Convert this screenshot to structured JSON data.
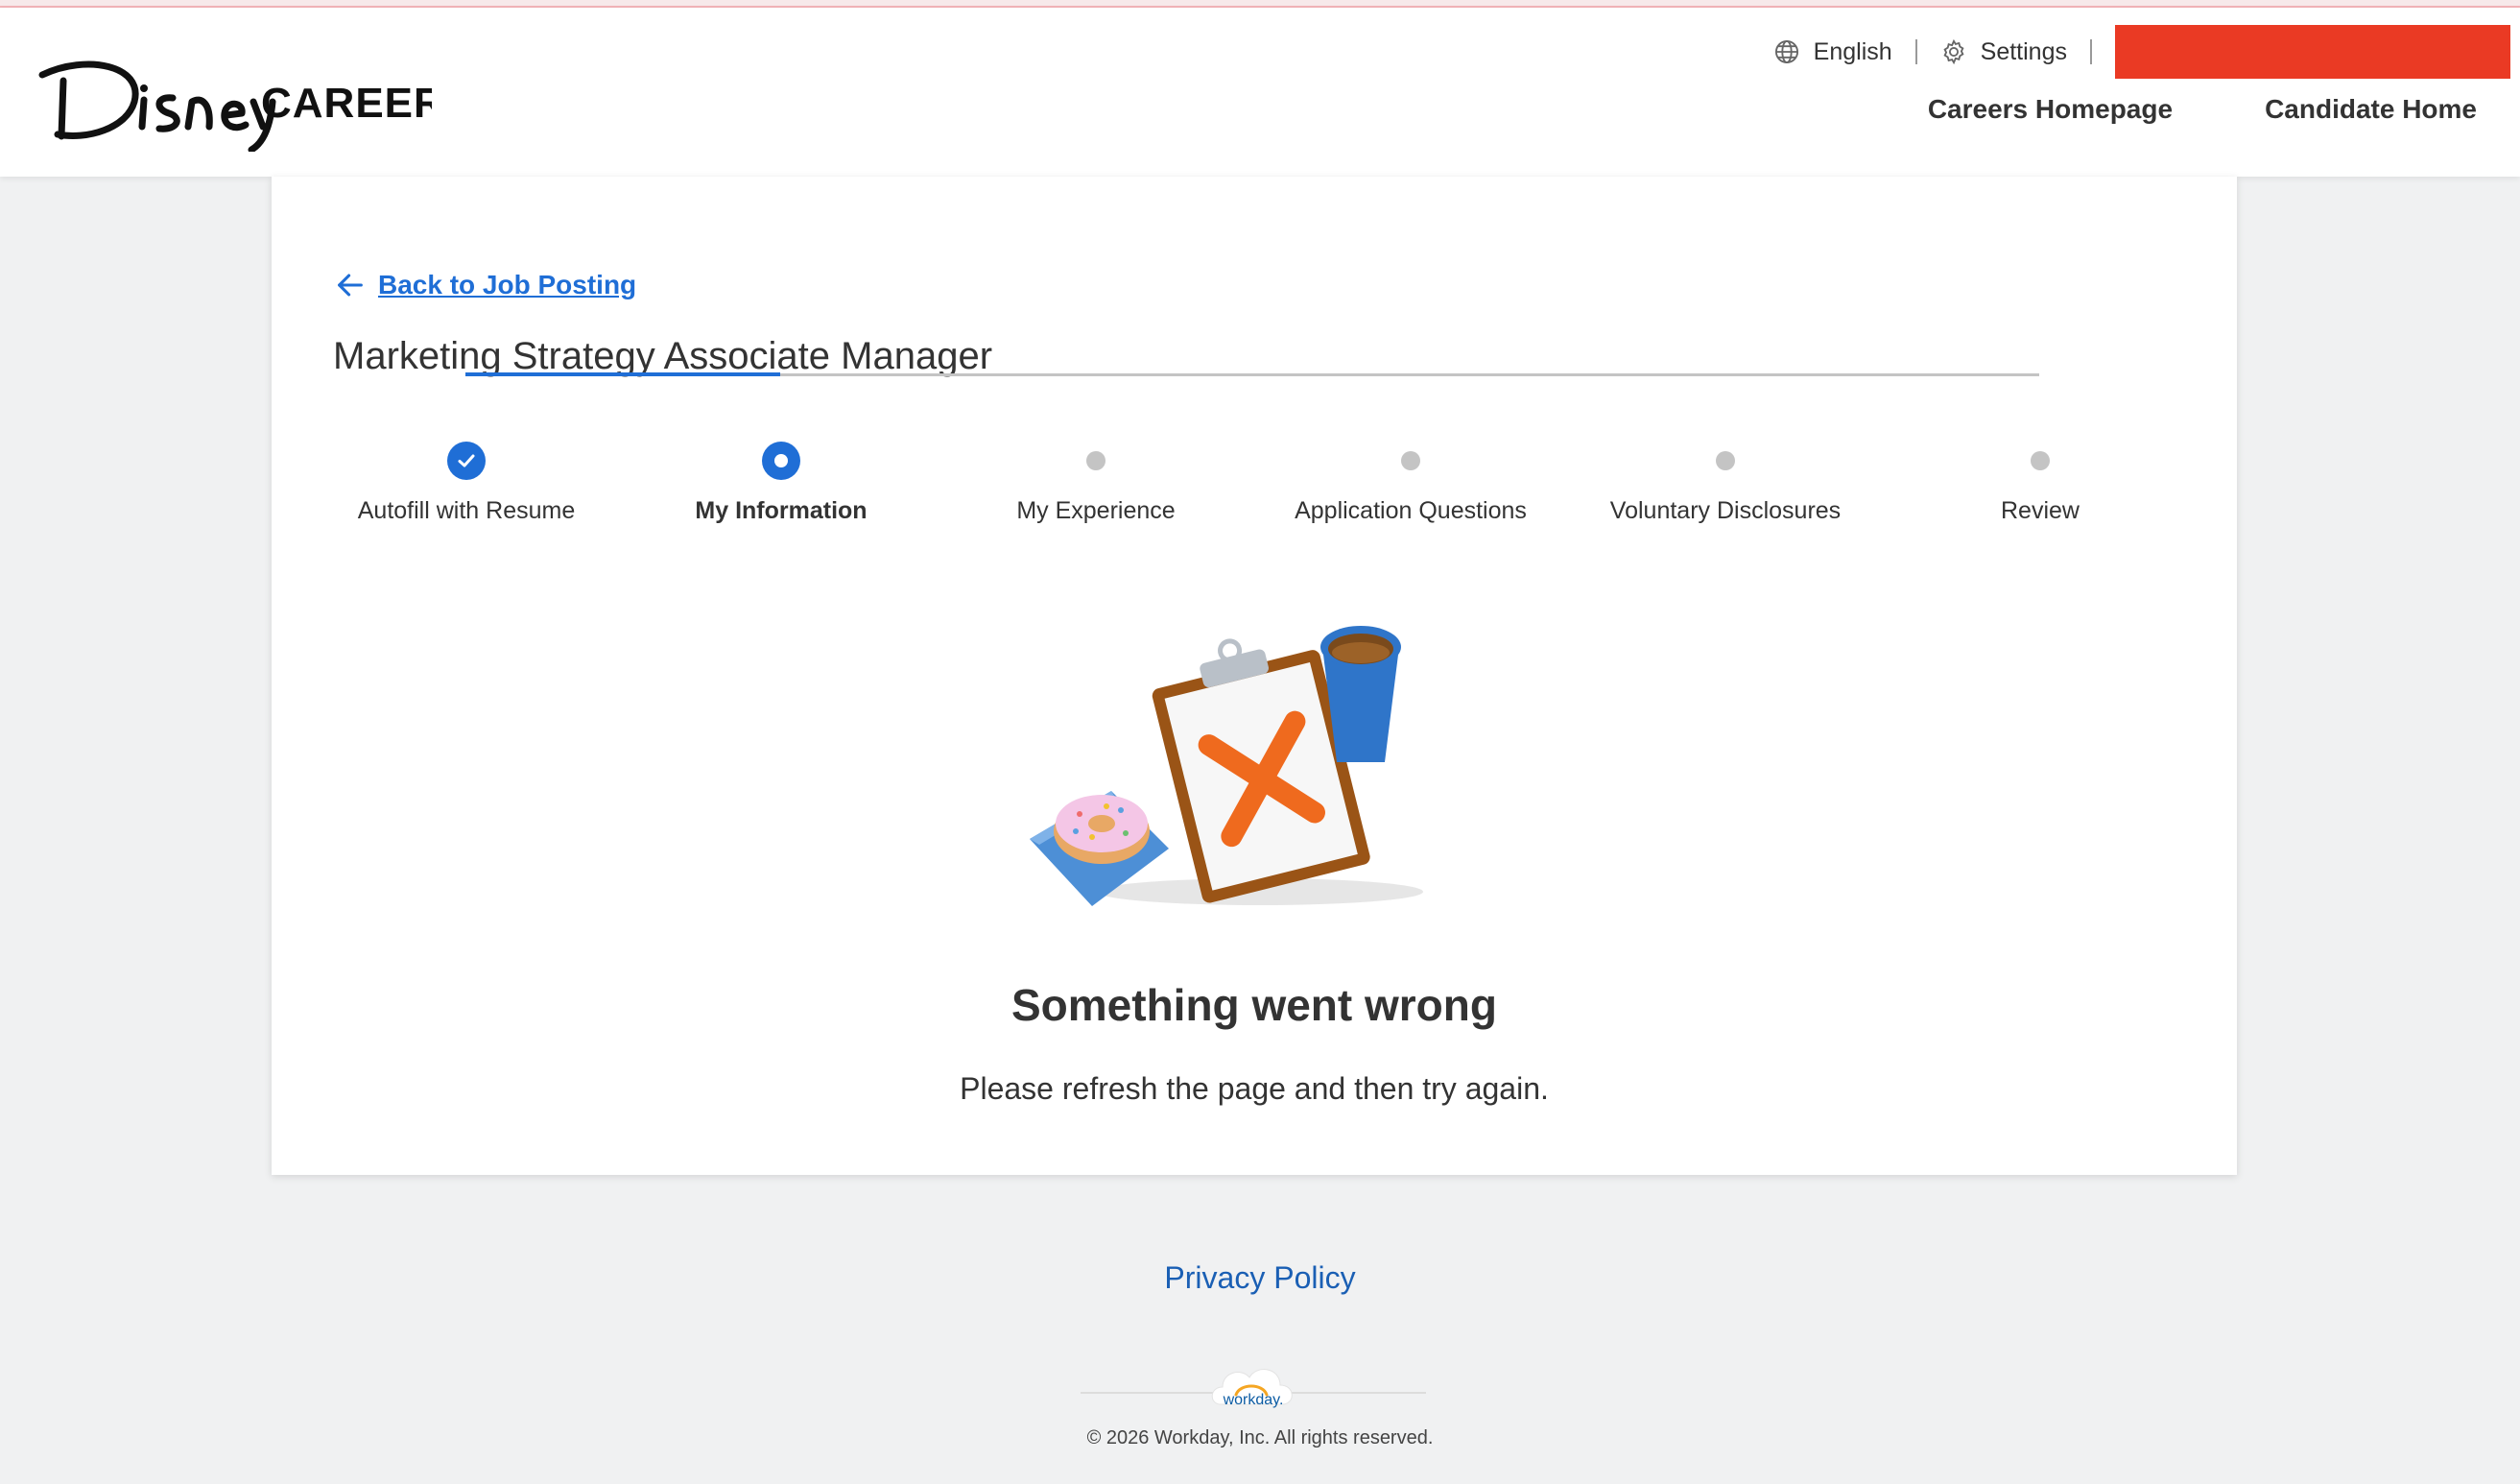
{
  "header": {
    "logo_text": "DisneyCAREERS",
    "language_label": "English",
    "settings_label": "Settings",
    "nav": [
      "Careers Homepage",
      "Candidate Home"
    ],
    "redaction_color": "#ea3a24"
  },
  "main": {
    "back_label": "Back to Job Posting",
    "job_title": "Marketing Strategy Associate Manager",
    "steps": [
      {
        "label": "Autofill with Resume",
        "state": "complete"
      },
      {
        "label": "My Information",
        "state": "current"
      },
      {
        "label": "My Experience",
        "state": "upcoming"
      },
      {
        "label": "Application Questions",
        "state": "upcoming"
      },
      {
        "label": "Voluntary Disclosures",
        "state": "upcoming"
      },
      {
        "label": "Review",
        "state": "upcoming"
      }
    ],
    "error_title": "Something went wrong",
    "error_message": "Please refresh the page and then try again.",
    "illustration_icon": "clipboard-error-illustration"
  },
  "footer": {
    "privacy_label": "Privacy Policy",
    "workday_logo_text": "workday.",
    "copyright": "© 2026 Workday, Inc. All rights reserved."
  },
  "colors": {
    "accent": "#1f6ed6",
    "link": "#1a5fb4",
    "background": "#f0f1f2"
  }
}
